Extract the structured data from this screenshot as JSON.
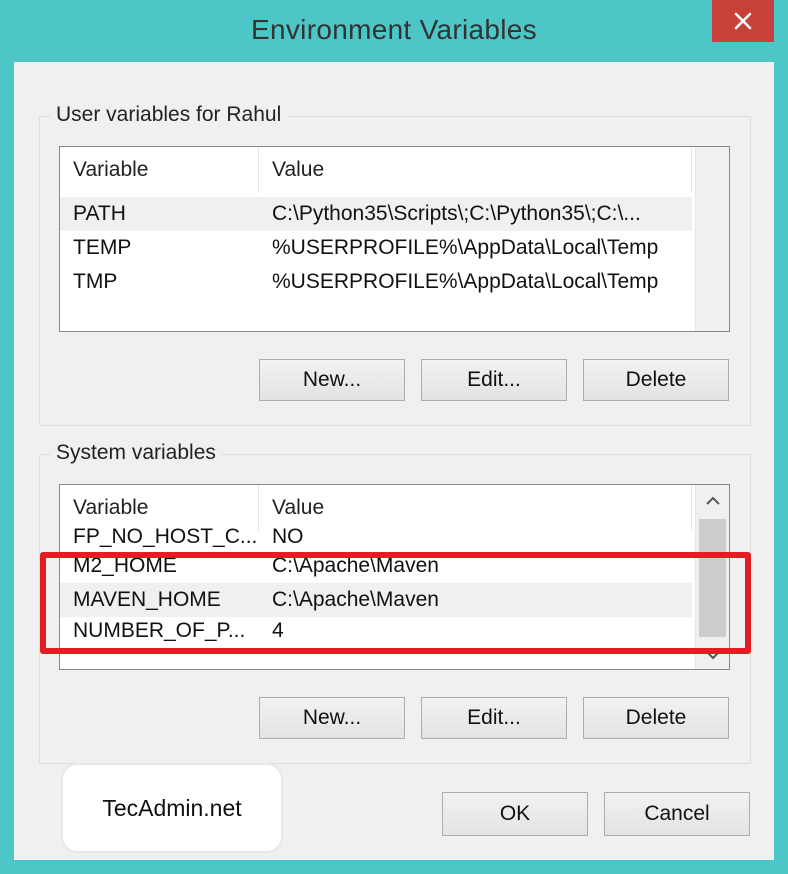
{
  "window": {
    "title": "Environment Variables",
    "close_label": "close"
  },
  "user_vars": {
    "label": "User variables for Rahul",
    "columns": [
      "Variable",
      "Value"
    ],
    "rows": [
      {
        "variable": "PATH",
        "value": "C:\\Python35\\Scripts\\;C:\\Python35\\;C:\\..."
      },
      {
        "variable": "TEMP",
        "value": "%USERPROFILE%\\AppData\\Local\\Temp"
      },
      {
        "variable": "TMP",
        "value": "%USERPROFILE%\\AppData\\Local\\Temp"
      }
    ],
    "buttons": {
      "new": "New...",
      "edit": "Edit...",
      "delete": "Delete"
    }
  },
  "system_vars": {
    "label": "System variables",
    "columns": [
      "Variable",
      "Value"
    ],
    "rows": [
      {
        "variable": "FP_NO_HOST_C...",
        "value": "NO"
      },
      {
        "variable": "M2_HOME",
        "value": "C:\\Apache\\Maven"
      },
      {
        "variable": "MAVEN_HOME",
        "value": "C:\\Apache\\Maven"
      },
      {
        "variable": "NUMBER_OF_P...",
        "value": "4"
      }
    ],
    "buttons": {
      "new": "New...",
      "edit": "Edit...",
      "delete": "Delete"
    }
  },
  "footer": {
    "ok": "OK",
    "cancel": "Cancel"
  },
  "watermark": {
    "text": "TecAdmin.net"
  },
  "colors": {
    "frame": "#4cc6c6",
    "close": "#c7403a",
    "highlight": "#e01e24"
  }
}
